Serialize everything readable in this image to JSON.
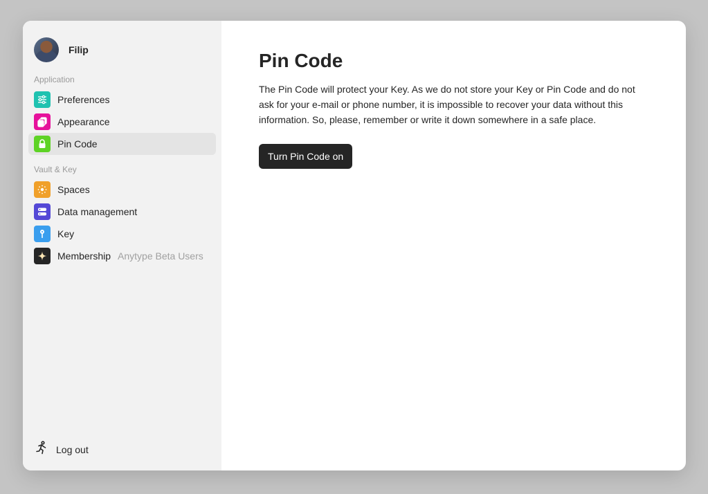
{
  "profile": {
    "name": "Filip"
  },
  "sections": {
    "application": "Application",
    "vault": "Vault & Key"
  },
  "nav": {
    "preferences": {
      "label": "Preferences",
      "icon": "sliders-icon",
      "color": "#1fc2b0"
    },
    "appearance": {
      "label": "Appearance",
      "icon": "layers-icon",
      "color": "#e6119b"
    },
    "pincode": {
      "label": "Pin Code",
      "icon": "lock-icon",
      "color": "#5ed325"
    },
    "spaces": {
      "label": "Spaces",
      "icon": "sun-icon",
      "color": "#f0a02a"
    },
    "data": {
      "label": "Data management",
      "icon": "database-icon",
      "color": "#5448d6"
    },
    "key": {
      "label": "Key",
      "icon": "key-icon",
      "color": "#3a9eee"
    },
    "membership": {
      "label": "Membership",
      "sublabel": "Anytype Beta Users",
      "icon": "sparkle-icon",
      "color": "#252525"
    }
  },
  "logout": {
    "label": "Log out"
  },
  "main": {
    "title": "Pin Code",
    "description": "The Pin Code will protect your Key. As we do not store your Key or Pin Code and do not ask for your e-mail or phone number, it is impossible to recover your data without this information. So, please, remember or write it down somewhere in a safe place.",
    "button": "Turn Pin Code on"
  }
}
